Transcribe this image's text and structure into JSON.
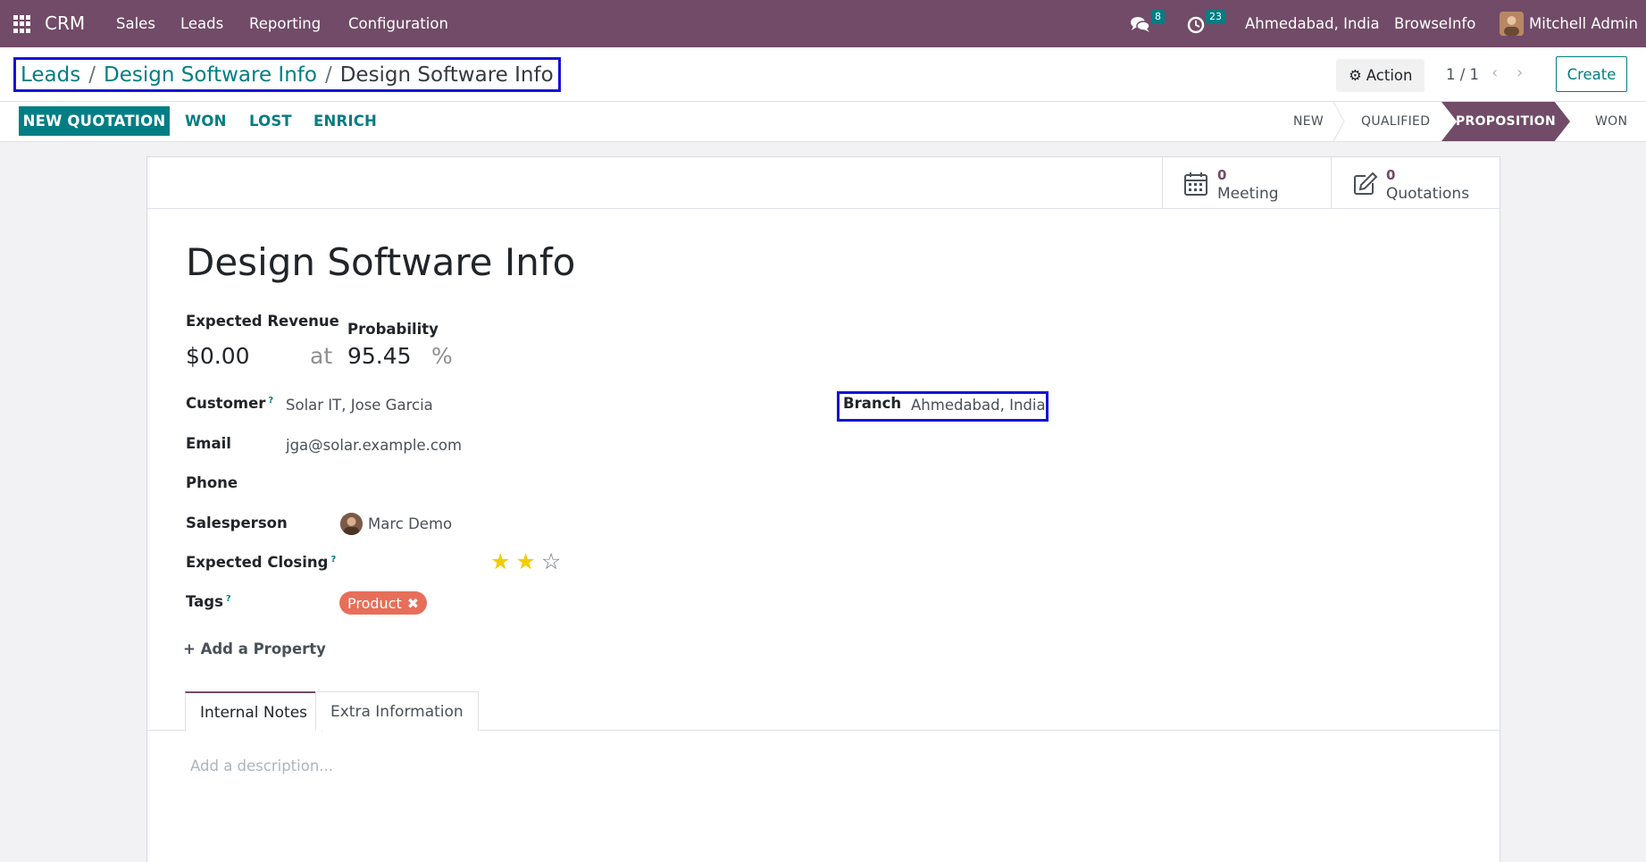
{
  "navbar": {
    "app_name": "CRM",
    "menu": [
      "Sales",
      "Leads",
      "Reporting",
      "Configuration"
    ],
    "messages_count": "8",
    "activities_count": "23",
    "company": "Ahmedabad, India",
    "branch_company": "BrowseInfo",
    "user": "Mitchell Admin"
  },
  "breadcrumb": {
    "items": [
      "Leads",
      "Design Software Info"
    ],
    "current": "Design Software Info",
    "separator": "/"
  },
  "control": {
    "action_label": "Action",
    "pager": "1 / 1",
    "create_label": "Create"
  },
  "statusbar": {
    "buttons": [
      "NEW QUOTATION",
      "WON",
      "LOST",
      "ENRICH"
    ],
    "stages": [
      "NEW",
      "QUALIFIED",
      "PROPOSITION",
      "WON"
    ],
    "current_stage": "PROPOSITION"
  },
  "smart_buttons": [
    {
      "value": "0",
      "label": "Meeting",
      "icon": "calendar-icon"
    },
    {
      "value": "0",
      "label": "Quotations",
      "icon": "pencil-square-icon"
    }
  ],
  "form": {
    "title": "Design Software Info",
    "expected_revenue_label": "Expected Revenue",
    "expected_revenue": "$0.00",
    "at_label": "at",
    "probability_label": "Probability",
    "probability": "95.45",
    "percent": "%",
    "customer_label": "Customer",
    "customer": "Solar IT, Jose Garcia",
    "email_label": "Email",
    "email": "jga@solar.example.com",
    "phone_label": "Phone",
    "salesperson_label": "Salesperson",
    "salesperson": "Marc Demo",
    "expected_closing_label": "Expected Closing",
    "priority_stars": 2,
    "priority_max": 3,
    "tags_label": "Tags",
    "tag": "Product",
    "add_property": "Add a Property",
    "branch_label": "Branch",
    "branch": "Ahmedabad, India",
    "help_marker": "?"
  },
  "tabs": [
    "Internal Notes",
    "Extra Information"
  ],
  "notes_placeholder": "Add a description...",
  "colors": {
    "brand": "#714b67",
    "accent": "#017e84",
    "tag": "#e76e58",
    "star": "#f3cc00"
  }
}
